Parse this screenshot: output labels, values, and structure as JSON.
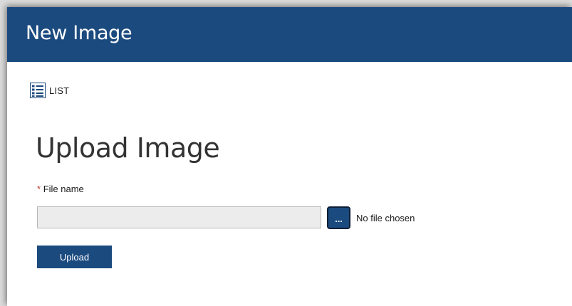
{
  "header": {
    "title": "New Image"
  },
  "nav": {
    "list_label": "LIST",
    "list_icon": "list-icon"
  },
  "main": {
    "heading": "Upload Image",
    "field": {
      "required_marker": "*",
      "label": "File name",
      "value": "",
      "browse_label": "...",
      "status_text": "No file chosen"
    },
    "upload_label": "Upload"
  },
  "colors": {
    "header_bg": "#1b4a7f",
    "button_bg": "#1b4a7f",
    "input_bg": "#ececec",
    "required_marker": "#c0392b"
  }
}
